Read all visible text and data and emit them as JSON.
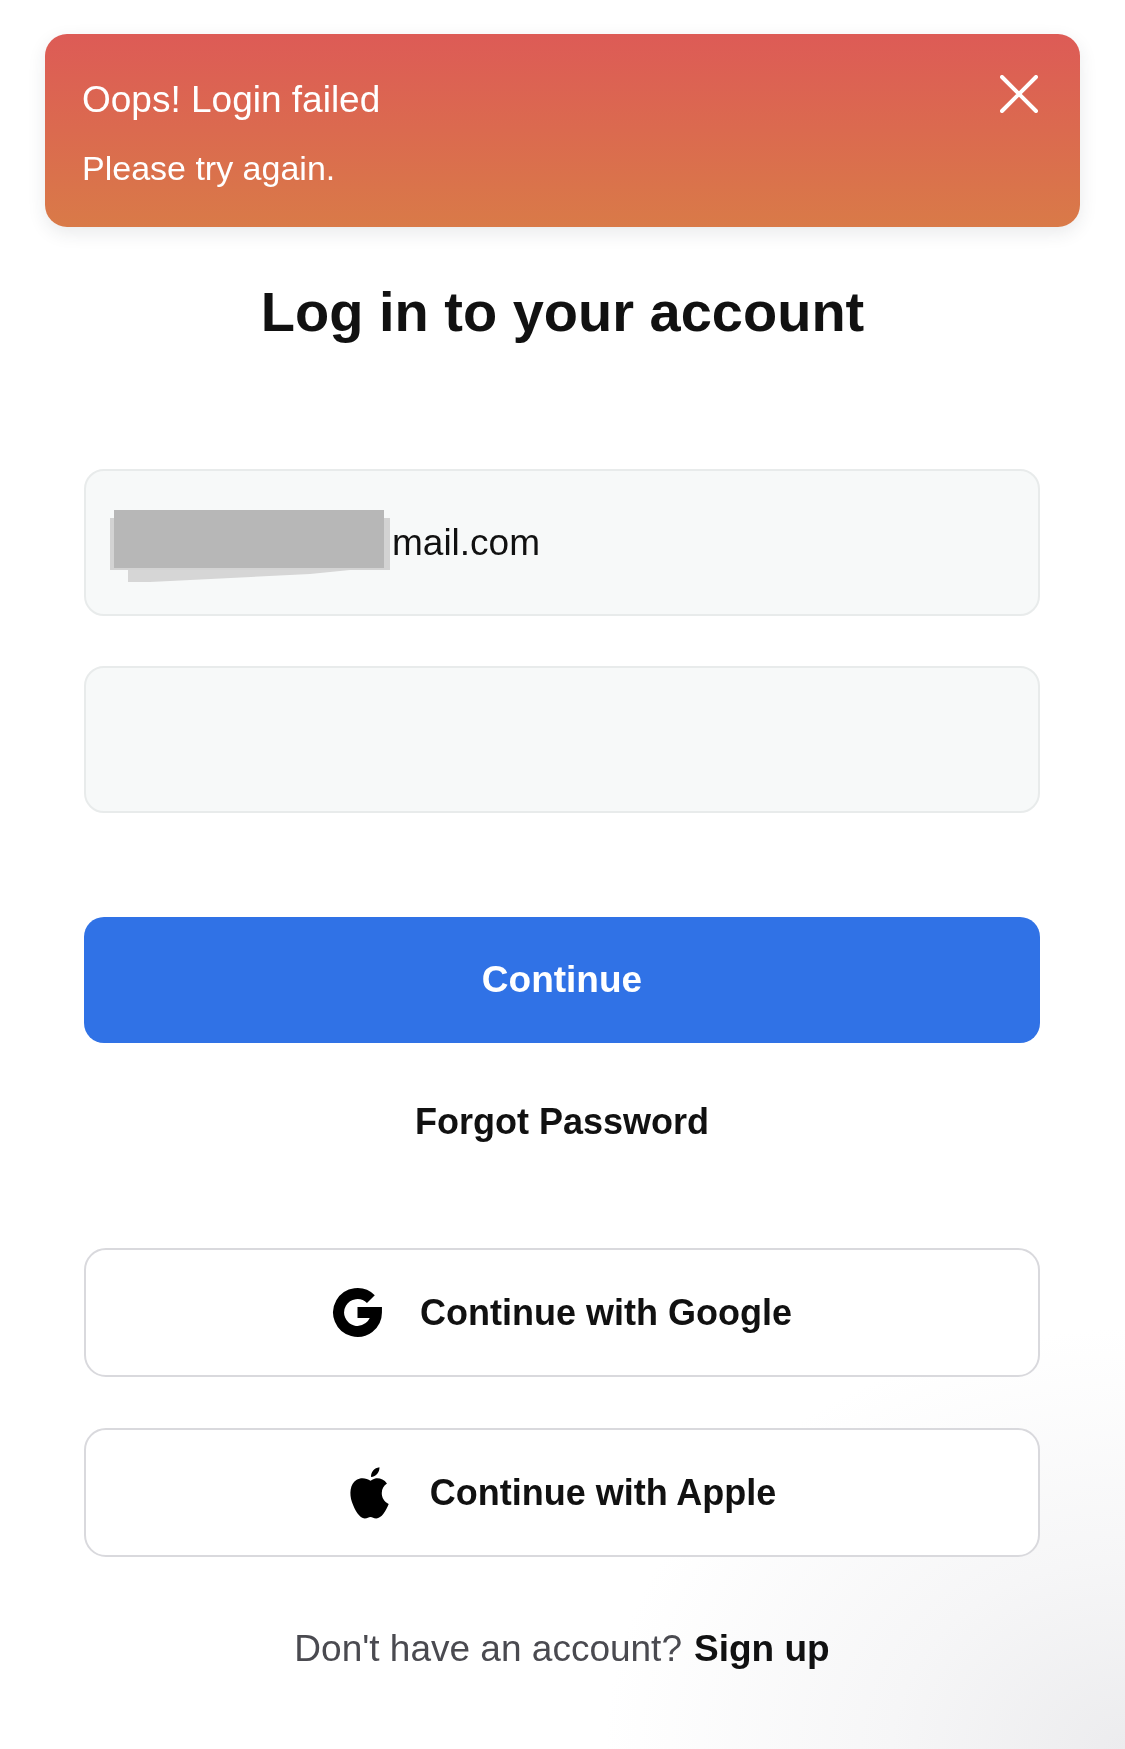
{
  "toast": {
    "title": "Oops! Login failed",
    "message": "Please try again."
  },
  "heading": "Log in to your account",
  "fields": [
    {
      "kind": "email",
      "value": "mail.com",
      "redacted": true
    },
    {
      "kind": "password"
    }
  ],
  "continue_button": "Continue",
  "forgot_password": "Forgot Password",
  "social_buttons": [
    {
      "kind": "google",
      "label": "Continue with Google"
    },
    {
      "kind": "apple",
      "label": "Continue with Apple"
    }
  ],
  "signup": {
    "prompt": "Don't have an account?",
    "link": "Sign up"
  }
}
